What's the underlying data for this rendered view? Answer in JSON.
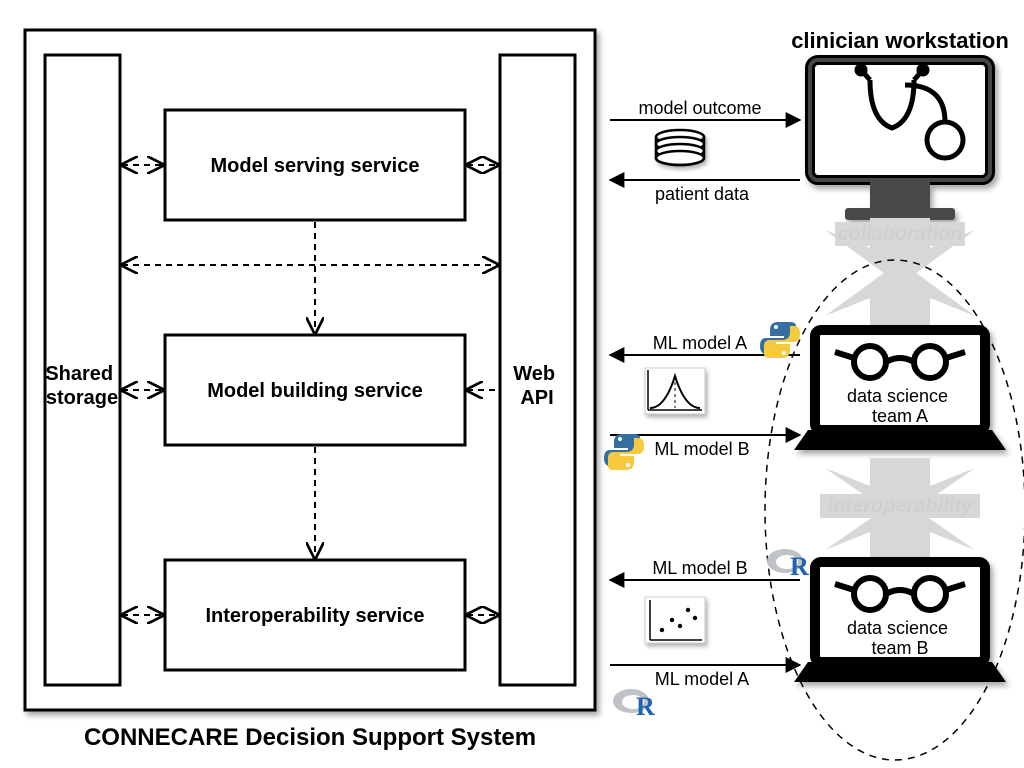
{
  "system_title": "CONNECARE Decision Support System",
  "left_box": "Shared\nstorage",
  "right_box": "Web\nAPI",
  "services": {
    "serving": "Model serving service",
    "building": "Model building service",
    "interop": "Interoperability service"
  },
  "clinician": {
    "title": "clinician workstation",
    "arrow_out_label": "model outcome",
    "arrow_in_label": "patient data"
  },
  "collaboration_label": "collaboration",
  "interoperability_label": "interoperability",
  "team_a": {
    "name": "data science\nteam A",
    "arrow_in_label": "ML model A",
    "arrow_out_label": "ML model B",
    "lang_in": "python",
    "lang_out": "python"
  },
  "team_b": {
    "name": "data science\nteam B",
    "arrow_in_label": "ML model B",
    "arrow_out_label": "ML model A",
    "lang_in": "R",
    "lang_out": "R"
  },
  "diagram_entities": [
    "Shared storage",
    "Model serving service",
    "Model building service",
    "Interoperability service",
    "Web API",
    "clinician workstation",
    "data science team A",
    "data science team B"
  ],
  "diagram_connections": [
    {
      "from": "Shared storage",
      "to": "Model serving service",
      "style": "bidirectional-dashed"
    },
    {
      "from": "Model serving service",
      "to": "Web API",
      "style": "bidirectional-dashed"
    },
    {
      "from": "Shared storage",
      "to": "Web API",
      "style": "bidirectional-dashed"
    },
    {
      "from": "Model serving service",
      "to": "Model building service",
      "style": "dashed-down"
    },
    {
      "from": "Shared storage",
      "to": "Model building service",
      "style": "bidirectional-dashed"
    },
    {
      "from": "Model building service",
      "to": "Web API",
      "style": "dashed-from-right"
    },
    {
      "from": "Model building service",
      "to": "Interoperability service",
      "style": "dashed-down"
    },
    {
      "from": "Shared storage",
      "to": "Interoperability service",
      "style": "bidirectional-dashed"
    },
    {
      "from": "Interoperability service",
      "to": "Web API",
      "style": "bidirectional-dashed"
    },
    {
      "from": "Web API",
      "to": "clinician workstation",
      "label": "model outcome",
      "style": "solid-arrow"
    },
    {
      "from": "clinician workstation",
      "to": "Web API",
      "label": "patient data",
      "style": "solid-arrow"
    },
    {
      "from": "clinician workstation",
      "to": "data science team A",
      "label": "collaboration",
      "style": "thick-gray-bidir"
    },
    {
      "from": "data science team A",
      "to": "Web API",
      "label": "ML model A",
      "lang": "python",
      "style": "solid-arrow"
    },
    {
      "from": "Web API",
      "to": "data science team A",
      "label": "ML model B",
      "lang": "python",
      "style": "solid-arrow"
    },
    {
      "from": "data science team A",
      "to": "data science team B",
      "label": "interoperability",
      "style": "thick-gray-bidir"
    },
    {
      "from": "data science team B",
      "to": "Web API",
      "label": "ML model B",
      "lang": "R",
      "style": "solid-arrow"
    },
    {
      "from": "Web API",
      "to": "data science team B",
      "label": "ML model A",
      "lang": "R",
      "style": "solid-arrow"
    }
  ]
}
